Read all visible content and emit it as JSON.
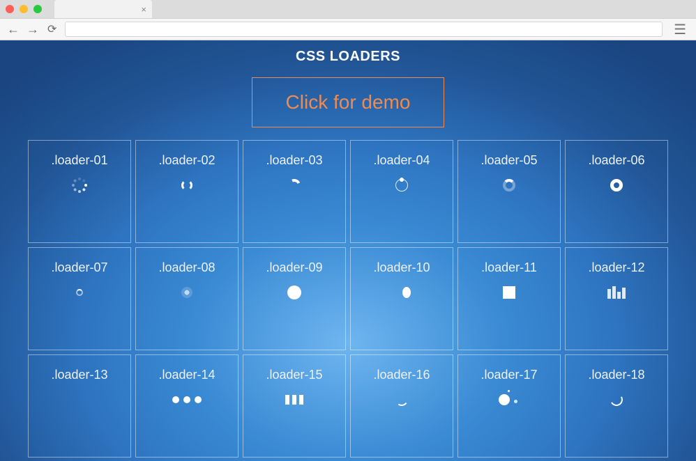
{
  "page": {
    "title": "CSS LOADERS",
    "demo_button": "Click for demo"
  },
  "loaders": [
    {
      "label": ".loader-01"
    },
    {
      "label": ".loader-02"
    },
    {
      "label": ".loader-03"
    },
    {
      "label": ".loader-04"
    },
    {
      "label": ".loader-05"
    },
    {
      "label": ".loader-06"
    },
    {
      "label": ".loader-07"
    },
    {
      "label": ".loader-08"
    },
    {
      "label": ".loader-09"
    },
    {
      "label": ".loader-10"
    },
    {
      "label": ".loader-11"
    },
    {
      "label": ".loader-12"
    },
    {
      "label": ".loader-13"
    },
    {
      "label": ".loader-14"
    },
    {
      "label": ".loader-15"
    },
    {
      "label": ".loader-16"
    },
    {
      "label": ".loader-17"
    },
    {
      "label": ".loader-18"
    }
  ]
}
